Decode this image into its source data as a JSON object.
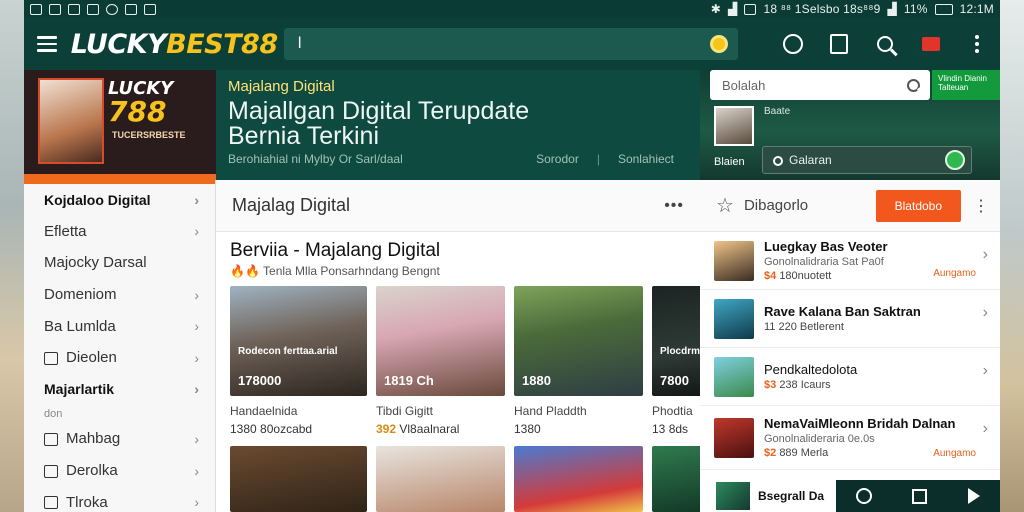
{
  "status": {
    "left_text": "",
    "right_text": "18 ⁸⁸ 1Selsbo 18s⁸⁸9",
    "battery": "11%",
    "time": "12:1M"
  },
  "header": {
    "logo_part1": "LUCKY",
    "logo_part2": "BEST88",
    "search_value": "l",
    "icons": [
      "hamburger-icon",
      "coin-icon",
      "timer-icon",
      "bookmark-icon",
      "search-icon",
      "notification-icon",
      "more-icon"
    ]
  },
  "hero_left": {
    "brand_top": "LUCKY",
    "brand_num": "788",
    "tagline": "TUCERSRBESTE"
  },
  "hero": {
    "subtitle": "Majalang Digital",
    "title_line1": "Majallgan Digital Terupdate",
    "title_line2": "Bernia Terkini",
    "meta": "Berohiahial ni Mylby Or Sarl/daal",
    "action1": "Sorodor",
    "action2": "Sonlahiect"
  },
  "sidebar": {
    "items": [
      {
        "label": "Kojdaloo Digital",
        "bold": true,
        "chev": true,
        "icon": false
      },
      {
        "label": "Efletta",
        "bold": false,
        "chev": true,
        "icon": false
      },
      {
        "label": "Majocky Darsal",
        "bold": false,
        "chev": false,
        "icon": false
      },
      {
        "label": "Domeniom",
        "bold": false,
        "chev": true,
        "icon": false
      },
      {
        "label": "Ba Lumlda",
        "bold": false,
        "chev": true,
        "icon": false
      },
      {
        "label": "Dieolen",
        "bold": false,
        "chev": true,
        "icon": true
      },
      {
        "label": "Majarlartik",
        "bold": true,
        "chev": true,
        "icon": false
      },
      {
        "label": "Mahbag",
        "bold": false,
        "chev": true,
        "icon": true
      },
      {
        "label": "Derolka",
        "bold": false,
        "chev": true,
        "icon": true
      },
      {
        "label": "Tlroka",
        "bold": false,
        "chev": true,
        "icon": true
      }
    ],
    "sub_note": "don"
  },
  "content": {
    "header_title": "Majalag Digital",
    "section_title": "Berviia - Majalang Digital",
    "section_meta": "Tenla Mlla Ponsarhndang Bengnt",
    "cards": [
      {
        "caption": "Rodecon ferttaa.arial",
        "num": "178000",
        "name": "Handaelnida",
        "stat_a": "1380",
        "stat_b": "80ozcabd"
      },
      {
        "caption": "",
        "num": "1819 Ch",
        "name": "Tibdi Gigitt",
        "stat_a": "392",
        "stat_b": "Vl8aalnaral"
      },
      {
        "caption": "",
        "num": "1880",
        "name": "Hand Pladdth",
        "stat_a": "1380",
        "stat_b": ""
      },
      {
        "caption": "Plocdrm",
        "num": "7800",
        "name": "Phodtia",
        "stat_a": "13",
        "stat_b": "8ds"
      }
    ]
  },
  "right_panel": {
    "search_placeholder": "Bolalah",
    "badge_text": "Vlindin Dianin Talteuan",
    "thumb_label": "Baate",
    "label2": "Blaien",
    "field_value": "Galaran",
    "head_title": "Dibagorlo",
    "head_button": "Blatdobo",
    "items": [
      {
        "title": "Luegkay Bas Veoter",
        "sub": "Gonolnalidraria Sat Pa0f",
        "meta_o": "$4",
        "meta": "180nuotett",
        "right": "Aungamo"
      },
      {
        "title": "Rave Kalana Ban Saktran",
        "sub": "",
        "meta_o": "",
        "meta": "11 220 Betlerent",
        "right": ""
      },
      {
        "title": "Pendkaltedolota",
        "sub": "",
        "meta_o": "$3",
        "meta": "238 Icaurs",
        "right": ""
      },
      {
        "title": "NemaVaiMleonn Bridah Dalnan",
        "sub": "Gonolnalideraria 0e.0s",
        "meta_o": "$2",
        "meta": "889 Merla",
        "right": "Aungamo"
      }
    ],
    "bottom_item": "Bsegrall Da"
  },
  "colors": {
    "header_bg": "#0b3f37",
    "accent_yellow": "#f6c21b",
    "accent_orange": "#f2581e",
    "hero_bg": "#0f4a40"
  }
}
